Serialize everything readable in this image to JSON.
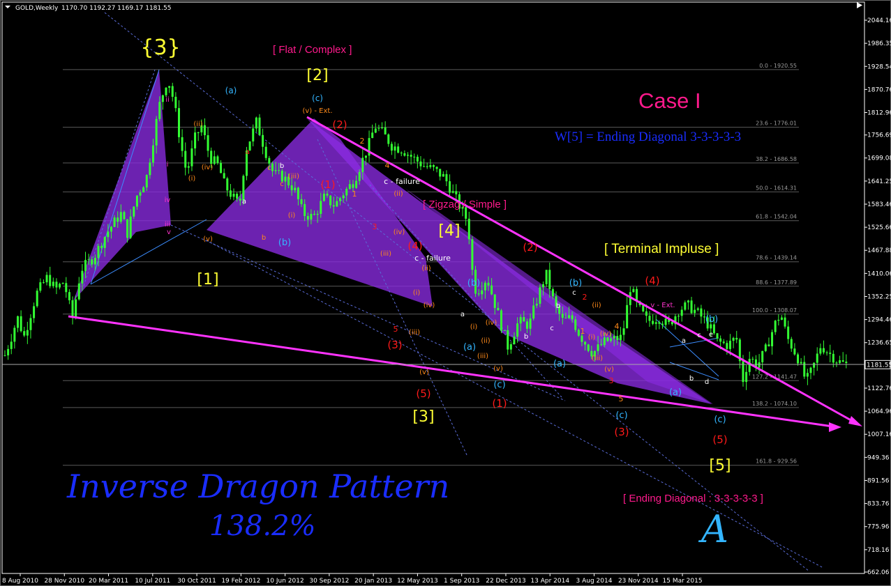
{
  "header": {
    "symbol": "GOLD,Weekly",
    "ohlc": "1170.70 1192.27 1169.17 1181.55"
  },
  "chart_data": {
    "type": "candlestick",
    "instrument": "GOLD",
    "timeframe": "Weekly",
    "y_range": [
      662.06,
      2044.16
    ],
    "y_ticks": [
      "2044.16",
      "1986.35",
      "1928.54",
      "1870.76",
      "1812.96",
      "1756.69",
      "1699.08",
      "1641.25",
      "1583.46",
      "1525.66",
      "1467.88",
      "1410.06",
      "1352.25",
      "1294.46",
      "1236.65",
      "1181.55",
      "1122.76",
      "1064.96",
      "1007.16",
      "949.36",
      "891.56",
      "833.76",
      "775.96",
      "718.16",
      "662.06"
    ],
    "current_price": "1181.55",
    "x_ticks": [
      "8 Aug 2010",
      "28 Nov 2010",
      "20 Mar 2011",
      "10 Jul 2011",
      "30 Oct 2011",
      "19 Feb 2012",
      "10 Jun 2012",
      "30 Sep 2012",
      "20 Jan 2013",
      "12 May 2013",
      "1 Sep 2013",
      "22 Dec 2013",
      "13 Apr 2014",
      "3 Aug 2014",
      "23 Nov 2014",
      "15 Mar 2015"
    ],
    "fib_levels": [
      {
        "label": "0.0 - 1920.55",
        "value": 1920.55
      },
      {
        "label": "23.6 - 1776.01",
        "value": 1776.01
      },
      {
        "label": "38.2 - 1686.58",
        "value": 1686.58
      },
      {
        "label": "50.0 - 1614.31",
        "value": 1614.31
      },
      {
        "label": "61.8 - 1542.04",
        "value": 1542.04
      },
      {
        "label": "78.6 - 1439.14",
        "value": 1439.14
      },
      {
        "label": "88.6 - 1377.89",
        "value": 1377.89
      },
      {
        "label": "100.0 - 1308.07",
        "value": 1308.07
      },
      {
        "label": "127.2 - 1141.47",
        "value": 1141.47
      },
      {
        "label": "138.2 - 1074.10",
        "value": 1074.1
      },
      {
        "label": "161.8 - 929.56",
        "value": 929.56
      }
    ],
    "price_path": [
      [
        0,
        1205
      ],
      [
        0.3,
        1250
      ],
      [
        0.6,
        1300
      ],
      [
        0.9,
        1250
      ],
      [
        1.5,
        1360
      ],
      [
        2.0,
        1400
      ],
      [
        2.4,
        1370
      ],
      [
        2.8,
        1390
      ],
      [
        3.0,
        1340
      ],
      [
        3.2,
        1300
      ],
      [
        3.6,
        1420
      ],
      [
        4.2,
        1450
      ],
      [
        4.8,
        1510
      ],
      [
        5.2,
        1540
      ],
      [
        5.5,
        1560
      ],
      [
        5.8,
        1510
      ],
      [
        6.2,
        1600
      ],
      [
        6.7,
        1650
      ],
      [
        7.3,
        1830
      ],
      [
        7.7,
        1900
      ],
      [
        8.0,
        1840
      ],
      [
        8.3,
        1740
      ],
      [
        8.6,
        1660
      ],
      [
        9.0,
        1750
      ],
      [
        9.3,
        1780
      ],
      [
        9.7,
        1700
      ],
      [
        10.1,
        1680
      ],
      [
        10.4,
        1630
      ],
      [
        10.8,
        1600
      ],
      [
        11.1,
        1580
      ],
      [
        11.4,
        1720
      ],
      [
        11.7,
        1760
      ],
      [
        11.9,
        1790
      ],
      [
        12.3,
        1720
      ],
      [
        12.7,
        1660
      ],
      [
        13.2,
        1650
      ],
      [
        13.7,
        1620
      ],
      [
        14.1,
        1560
      ],
      [
        14.6,
        1550
      ],
      [
        15.1,
        1600
      ],
      [
        15.6,
        1580
      ],
      [
        16.0,
        1610
      ],
      [
        16.5,
        1640
      ],
      [
        17.2,
        1730
      ],
      [
        17.5,
        1780
      ],
      [
        17.9,
        1760
      ],
      [
        18.3,
        1730
      ],
      [
        18.8,
        1720
      ],
      [
        19.3,
        1700
      ],
      [
        19.8,
        1680
      ],
      [
        20.3,
        1670
      ],
      [
        20.8,
        1650
      ],
      [
        21.3,
        1600
      ],
      [
        21.7,
        1560
      ],
      [
        21.9,
        1540
      ],
      [
        22.1,
        1420
      ],
      [
        22.3,
        1360
      ],
      [
        22.8,
        1400
      ],
      [
        23.2,
        1330
      ],
      [
        23.8,
        1225
      ],
      [
        24.3,
        1290
      ],
      [
        24.8,
        1280
      ],
      [
        25.2,
        1350
      ],
      [
        25.6,
        1410
      ],
      [
        26.0,
        1330
      ],
      [
        26.4,
        1290
      ],
      [
        26.8,
        1300
      ],
      [
        27.2,
        1255
      ],
      [
        27.8,
        1210
      ],
      [
        28.4,
        1240
      ],
      [
        29.2,
        1250
      ],
      [
        29.6,
        1380
      ],
      [
        29.9,
        1330
      ],
      [
        30.4,
        1290
      ],
      [
        30.9,
        1300
      ],
      [
        31.4,
        1280
      ],
      [
        31.9,
        1320
      ],
      [
        32.3,
        1330
      ],
      [
        32.8,
        1310
      ],
      [
        33.3,
        1280
      ],
      [
        33.7,
        1240
      ],
      [
        34.2,
        1230
      ],
      [
        34.6,
        1250
      ],
      [
        34.9,
        1140
      ],
      [
        35.2,
        1200
      ],
      [
        35.6,
        1180
      ],
      [
        36.0,
        1220
      ],
      [
        36.4,
        1280
      ],
      [
        36.7,
        1310
      ],
      [
        37.0,
        1250
      ],
      [
        37.5,
        1200
      ],
      [
        37.9,
        1140
      ],
      [
        38.2,
        1170
      ],
      [
        38.6,
        1230
      ],
      [
        39.0,
        1210
      ],
      [
        39.4,
        1190
      ],
      [
        39.8,
        1182
      ]
    ],
    "wave_labels": [
      "{3}",
      "[2]",
      "[1]",
      "[4]",
      "[3]",
      "[5]",
      "(1)",
      "(2)",
      "(3)",
      "(4)",
      "(5)",
      "(a)",
      "(b)",
      "(c)",
      "(i)",
      "(ii)",
      "(iii)",
      "(iv)",
      "(v)",
      "(v) - Ext.",
      "v - Ext.",
      "c - failure",
      "i",
      "ii",
      "iii",
      "iv",
      "v",
      "1",
      "2",
      "3",
      "4",
      "5",
      "a",
      "b",
      "c",
      "d",
      "e"
    ]
  },
  "annotations": {
    "flat_complex": "[ Flat / Complex ]",
    "zigzag_simple": "[ Zigzag / Simple ]",
    "case": "Case I",
    "ending_diag_w": "W[5] = Ending Diagonal 3-3-3-3-3",
    "terminal": "[ Terminal Impluse ]",
    "ending_diag": "[ Ending Diagonal : 3-3-3-3-3 ]",
    "pattern_title": "Inverse Dragon Pattern",
    "pattern_pct": "138.2%",
    "logo": "A"
  },
  "colors": {
    "background": "#000000",
    "candles": "#33ff33",
    "trendline": "#ff33ff",
    "fill": "#8a2be2",
    "dotted": "#5a6cd8",
    "yellow": "#ffff33",
    "red": "#ff1a1a",
    "cyan": "#33b5ff",
    "magenta": "#ff33cc",
    "orange": "#ff8a1a",
    "blue": "#1a2dff",
    "grid": "#5a5a5a"
  }
}
